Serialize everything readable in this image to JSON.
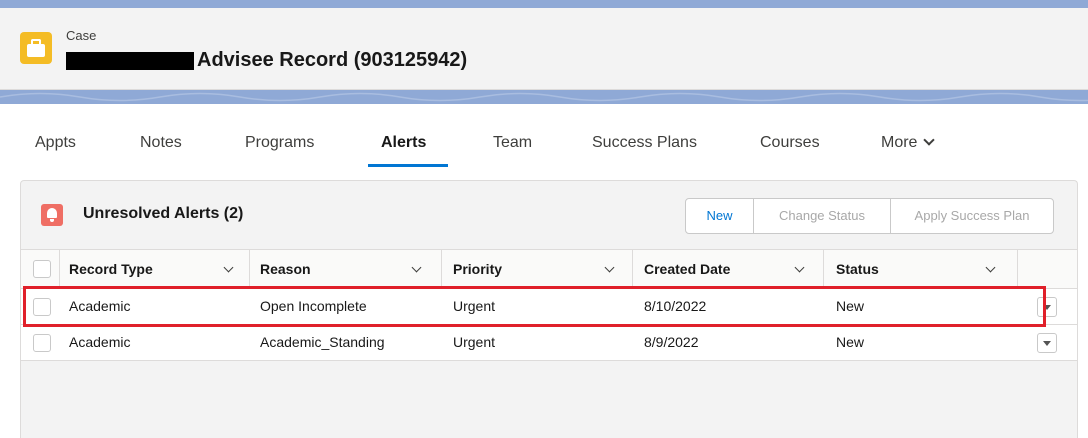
{
  "header": {
    "object_label": "Case",
    "record_title": "Advisee Record (903125942)",
    "icon": "briefcase-icon"
  },
  "tabs": {
    "items": [
      "Appts",
      "Notes",
      "Programs",
      "Alerts",
      "Team",
      "Success Plans",
      "Courses",
      "More"
    ],
    "active": "Alerts"
  },
  "card": {
    "icon": "bell-icon",
    "title": "Unresolved Alerts (2)",
    "buttons": {
      "new": "New",
      "change_status": "Change Status",
      "apply_success_plan": "Apply Success Plan"
    }
  },
  "table": {
    "columns": [
      "Record Type",
      "Reason",
      "Priority",
      "Created Date",
      "Status"
    ],
    "rows": [
      {
        "record_type": "Academic",
        "reason": "Open Incomplete",
        "priority": "Urgent",
        "created_date": "8/10/2022",
        "status": "New",
        "highlighted": true
      },
      {
        "record_type": "Academic",
        "reason": "Academic_Standing",
        "priority": "Urgent",
        "created_date": "8/9/2022",
        "status": "New",
        "highlighted": false
      }
    ]
  },
  "colors": {
    "accent": "#0176d3",
    "case_icon": "#f4bc25",
    "alert_icon": "#ef6e64",
    "highlight_box": "#e0202a",
    "banner": "#8fa9d6"
  }
}
